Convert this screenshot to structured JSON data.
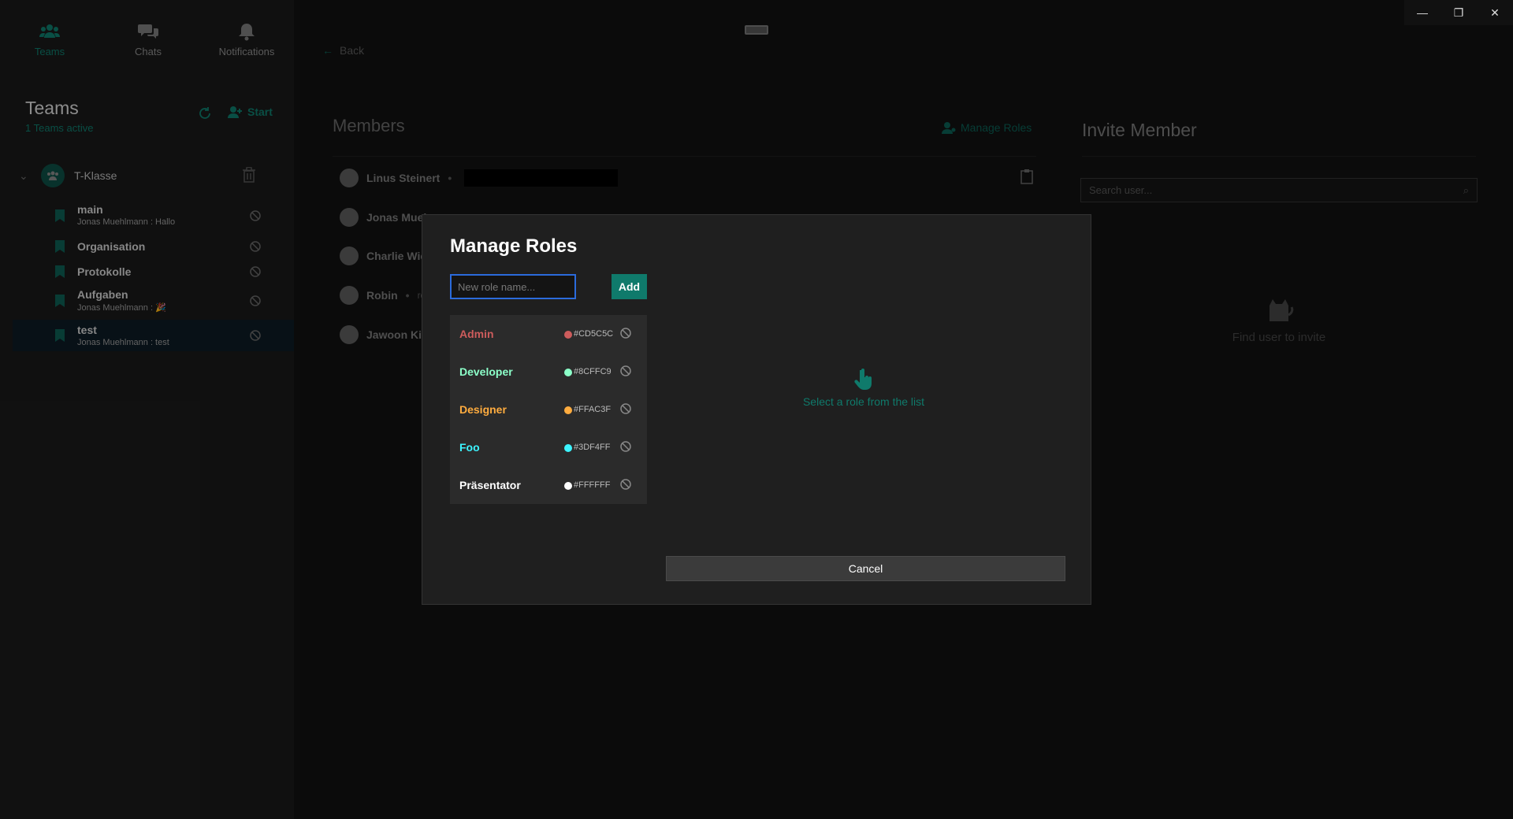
{
  "nav": {
    "teams": "Teams",
    "chats": "Chats",
    "notifications": "Notifications"
  },
  "sidebar": {
    "title": "Teams",
    "subtitle": "1 Teams active",
    "start_label": "Start",
    "team_name": "T-Klasse",
    "channels": [
      {
        "name": "main",
        "preview": "Jonas Muehlmann : Hallo"
      },
      {
        "name": "Organisation",
        "preview": ""
      },
      {
        "name": "Protokolle",
        "preview": ""
      },
      {
        "name": "Aufgaben",
        "preview": "Jonas Muehlmann : 🎉"
      },
      {
        "name": "test",
        "preview": "Jonas Muehlmann : test"
      }
    ]
  },
  "main": {
    "back_label": "Back",
    "members_title": "Members",
    "manage_roles_label": "Manage Roles",
    "members": [
      {
        "name": "Linus Steinert"
      },
      {
        "name": "Jonas Muel"
      },
      {
        "name": "Charlie Wie"
      },
      {
        "name": "Robin",
        "extra": "rob"
      },
      {
        "name": "Jawoon Kir"
      }
    ],
    "invite_title": "Invite Member",
    "search_placeholder": "Search user...",
    "find_text": "Find user to invite"
  },
  "modal": {
    "title": "Manage Roles",
    "input_placeholder": "New role name...",
    "add_label": "Add",
    "roles": [
      {
        "name": "Admin",
        "hex": "#CD5C5C",
        "color": "#CD5C5C"
      },
      {
        "name": "Developer",
        "hex": "#8CFFC9",
        "color": "#8CFFC9"
      },
      {
        "name": "Designer",
        "hex": "#FFAC3F",
        "color": "#FFAC3F"
      },
      {
        "name": "Foo",
        "hex": "#3DF4FF",
        "color": "#3DF4FF"
      },
      {
        "name": "Präsentator",
        "hex": "#FFFFFF",
        "color": "#FFFFFF"
      }
    ],
    "hint": "Select a role from the list",
    "cancel_label": "Cancel"
  },
  "colors": {
    "accent": "#0f7a6b",
    "input_focus": "#2b6bdc"
  }
}
